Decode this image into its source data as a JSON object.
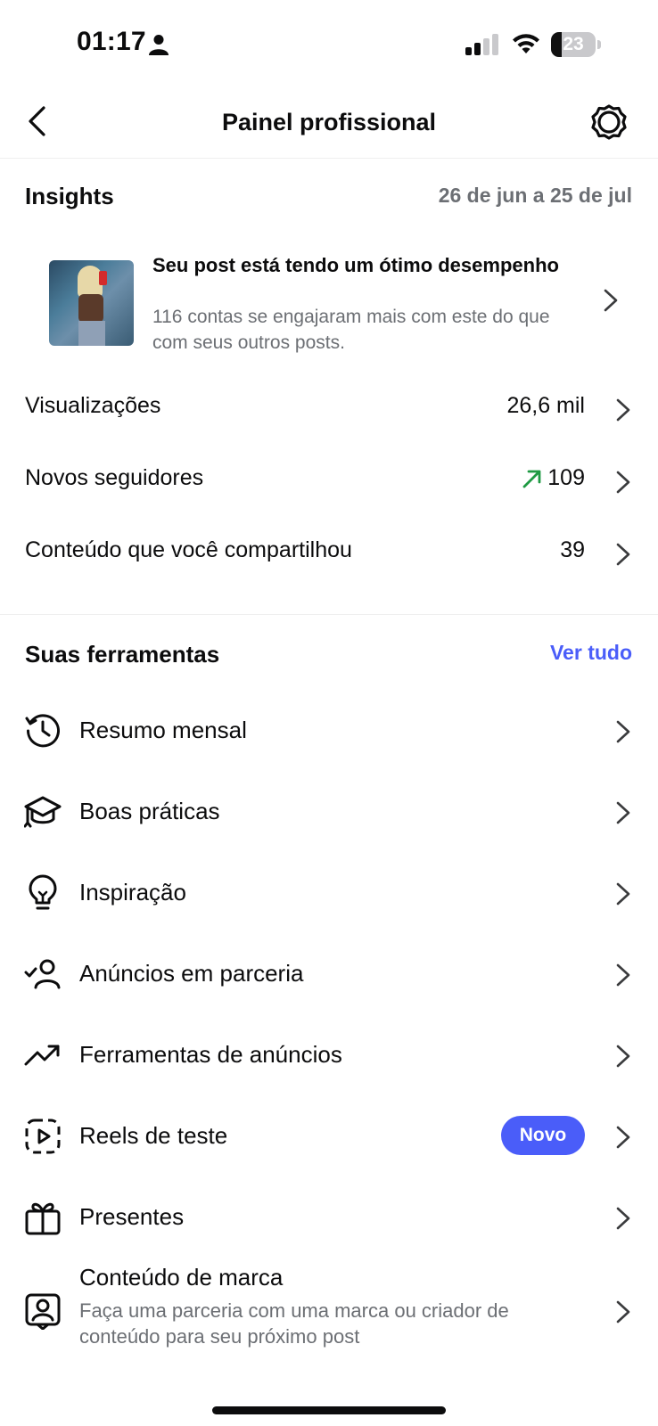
{
  "status_bar": {
    "time": "01:17",
    "battery_level": "23",
    "battery_fraction": 0.23,
    "icons": [
      "person-icon",
      "signal-icon",
      "wifi-icon",
      "battery-icon"
    ]
  },
  "header": {
    "title": "Painel profissional",
    "back_icon": "chevron-left-icon",
    "settings_icon": "gear-icon"
  },
  "insights": {
    "title": "Insights",
    "date_range": "26 de jun a 25 de jul",
    "post_card": {
      "title": "Seu post está tendo um ótimo desempenho",
      "subtitle": "116 contas se engajaram mais com este do que com seus outros posts."
    },
    "metrics": [
      {
        "label": "Visualizações",
        "value": "26,6 mil"
      },
      {
        "label": "Novos seguidores",
        "value": "109",
        "trend": "up",
        "trend_color": "#1f9a43"
      },
      {
        "label": "Conteúdo que você compartilhou",
        "value": "39"
      }
    ]
  },
  "tools": {
    "title": "Suas ferramentas",
    "see_all": "Ver tudo",
    "accent_color": "#4a5df9",
    "items": [
      {
        "label": "Resumo mensal",
        "icon": "history-icon"
      },
      {
        "label": "Boas práticas",
        "icon": "graduation-cap-icon"
      },
      {
        "label": "Inspiração",
        "icon": "lightbulb-icon"
      },
      {
        "label": "Anúncios em parceria",
        "icon": "person-check-icon"
      },
      {
        "label": "Ferramentas de anúncios",
        "icon": "trend-line-icon"
      },
      {
        "label": "Reels de teste",
        "icon": "reels-test-icon",
        "badge": "Novo"
      },
      {
        "label": "Presentes",
        "icon": "gift-icon"
      },
      {
        "label": "Conteúdo de marca",
        "icon": "branded-content-icon",
        "subtitle": "Faça uma parceria com uma marca ou criador de conteúdo para seu próximo post"
      }
    ]
  }
}
